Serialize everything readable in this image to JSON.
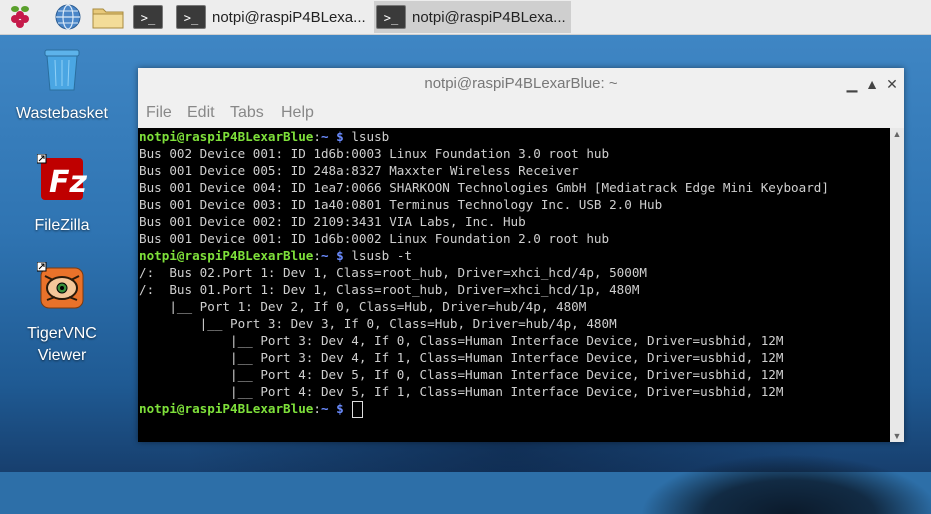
{
  "taskbar": {
    "tasks": [
      {
        "label": "notpi@raspiP4BLexa..."
      },
      {
        "label": "notpi@raspiP4BLexa..."
      }
    ]
  },
  "desktop": {
    "icons": [
      {
        "label": "Wastebasket"
      },
      {
        "label": "FileZilla"
      },
      {
        "label": "TigerVNC Viewer"
      }
    ]
  },
  "window": {
    "title": "notpi@raspiP4BLexarBlue: ~",
    "menu": [
      "File",
      "Edit",
      "Tabs",
      "Help"
    ]
  },
  "terminal": {
    "prompt_user": "notpi@raspiP4BLexarBlue",
    "prompt_sep": ":",
    "prompt_path": "~",
    "prompt_symbol": " $ ",
    "command1": "lsusb",
    "output1": [
      "Bus 002 Device 001: ID 1d6b:0003 Linux Foundation 3.0 root hub",
      "Bus 001 Device 005: ID 248a:8327 Maxxter Wireless Receiver",
      "Bus 001 Device 004: ID 1ea7:0066 SHARKOON Technologies GmbH [Mediatrack Edge Mini Keyboard]",
      "Bus 001 Device 003: ID 1a40:0801 Terminus Technology Inc. USB 2.0 Hub",
      "Bus 001 Device 002: ID 2109:3431 VIA Labs, Inc. Hub",
      "Bus 001 Device 001: ID 1d6b:0002 Linux Foundation 2.0 root hub"
    ],
    "command2": "lsusb -t",
    "output2": [
      "/:  Bus 02.Port 1: Dev 1, Class=root_hub, Driver=xhci_hcd/4p, 5000M",
      "/:  Bus 01.Port 1: Dev 1, Class=root_hub, Driver=xhci_hcd/1p, 480M",
      "    |__ Port 1: Dev 2, If 0, Class=Hub, Driver=hub/4p, 480M",
      "        |__ Port 3: Dev 3, If 0, Class=Hub, Driver=hub/4p, 480M",
      "            |__ Port 3: Dev 4, If 0, Class=Human Interface Device, Driver=usbhid, 12M",
      "            |__ Port 3: Dev 4, If 1, Class=Human Interface Device, Driver=usbhid, 12M",
      "            |__ Port 4: Dev 5, If 0, Class=Human Interface Device, Driver=usbhid, 12M",
      "            |__ Port 4: Dev 5, If 1, Class=Human Interface Device, Driver=usbhid, 12M"
    ]
  }
}
